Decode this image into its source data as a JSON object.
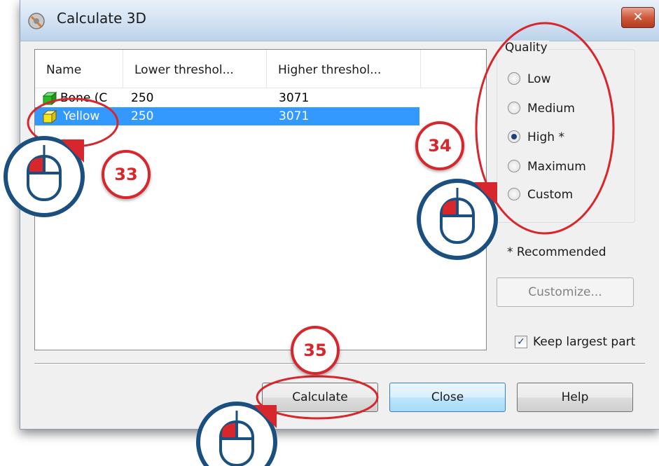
{
  "window": {
    "title": "Calculate 3D",
    "close_glyph": "✕"
  },
  "list": {
    "columns": [
      "Name",
      "Lower threshol...",
      "Higher threshol..."
    ],
    "rows": [
      {
        "name": "Bone (C",
        "lower": "250",
        "higher": "3071",
        "color": "#22c022",
        "selected": false
      },
      {
        "name": "Yellow",
        "lower": "250",
        "higher": "3071",
        "color": "#f5e61a",
        "selected": true
      }
    ]
  },
  "quality": {
    "legend": "Quality",
    "options": [
      {
        "label": "Low",
        "checked": false
      },
      {
        "label": "Medium",
        "checked": false
      },
      {
        "label": "High *",
        "checked": true
      },
      {
        "label": "Maximum",
        "checked": false
      },
      {
        "label": "Custom",
        "checked": false
      }
    ],
    "note": "* Recommended"
  },
  "buttons": {
    "customize": "Customize...",
    "calculate": "Calculate",
    "close": "Close",
    "help": "Help"
  },
  "keep_largest": {
    "label": "Keep largest part",
    "checked": true
  },
  "annotations": {
    "step_33": "33",
    "step_34": "34",
    "step_35": "35",
    "accent_color": "#d7262c",
    "mouse_color": "#1a4f80"
  }
}
